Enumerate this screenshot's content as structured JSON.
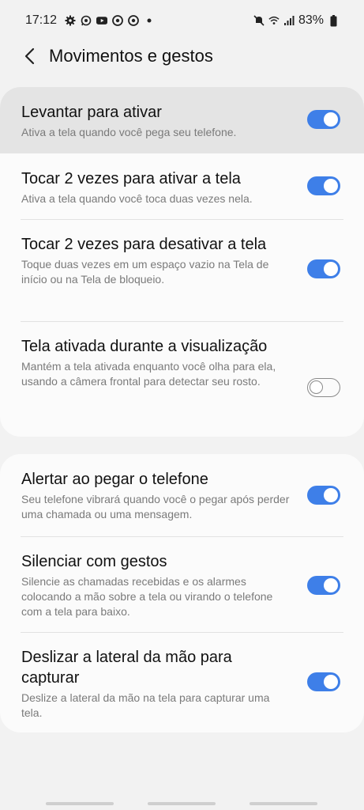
{
  "status_bar": {
    "time": "17:12",
    "battery": "83%",
    "left_icons": [
      "gear-icon",
      "whatsapp-icon",
      "youtube-icon",
      "chrome-icon",
      "chrome-icon",
      "dot-icon"
    ],
    "right_icons": [
      "mute-icon",
      "wifi-icon",
      "signal-icon",
      "battery-icon"
    ]
  },
  "header": {
    "title": "Movimentos e gestos"
  },
  "section1": [
    {
      "title": "Levantar para ativar",
      "desc": "Ativa a tela quando você pega seu telefone.",
      "toggle": "on",
      "highlighted": true
    },
    {
      "title": "Tocar 2 vezes para ativar a tela",
      "desc": "Ativa a tela quando você toca duas vezes nela.",
      "toggle": "on"
    },
    {
      "title": "Tocar 2 vezes para desativar a tela",
      "desc": "Toque duas vezes em um espaço vazio na Tela de início ou na Tela de bloqueio.",
      "toggle": "on"
    },
    {
      "title": "Tela ativada durante a visualização",
      "desc": "Mantém a tela ativada enquanto você olha para ela, usando a câmera frontal para detectar seu rosto.",
      "toggle": "off"
    }
  ],
  "section2": [
    {
      "title": "Alertar ao pegar o telefone",
      "desc": "Seu telefone vibrará quando você o pegar após perder uma chamada ou uma mensagem.",
      "toggle": "on"
    },
    {
      "title": "Silenciar com gestos",
      "desc": "Silencie as chamadas recebidas e os alarmes colocando a mão sobre a tela ou virando o telefone com a tela para baixo.",
      "toggle": "on"
    },
    {
      "title": "Deslizar a lateral da mão para capturar",
      "desc": "Deslize a lateral da mão na tela para capturar uma tela.",
      "toggle": "on"
    }
  ],
  "colors": {
    "accent": "#3e7fe8",
    "background": "#f2f2f2",
    "card": "#fbfbfb",
    "highlight": "#e4e4e4"
  }
}
